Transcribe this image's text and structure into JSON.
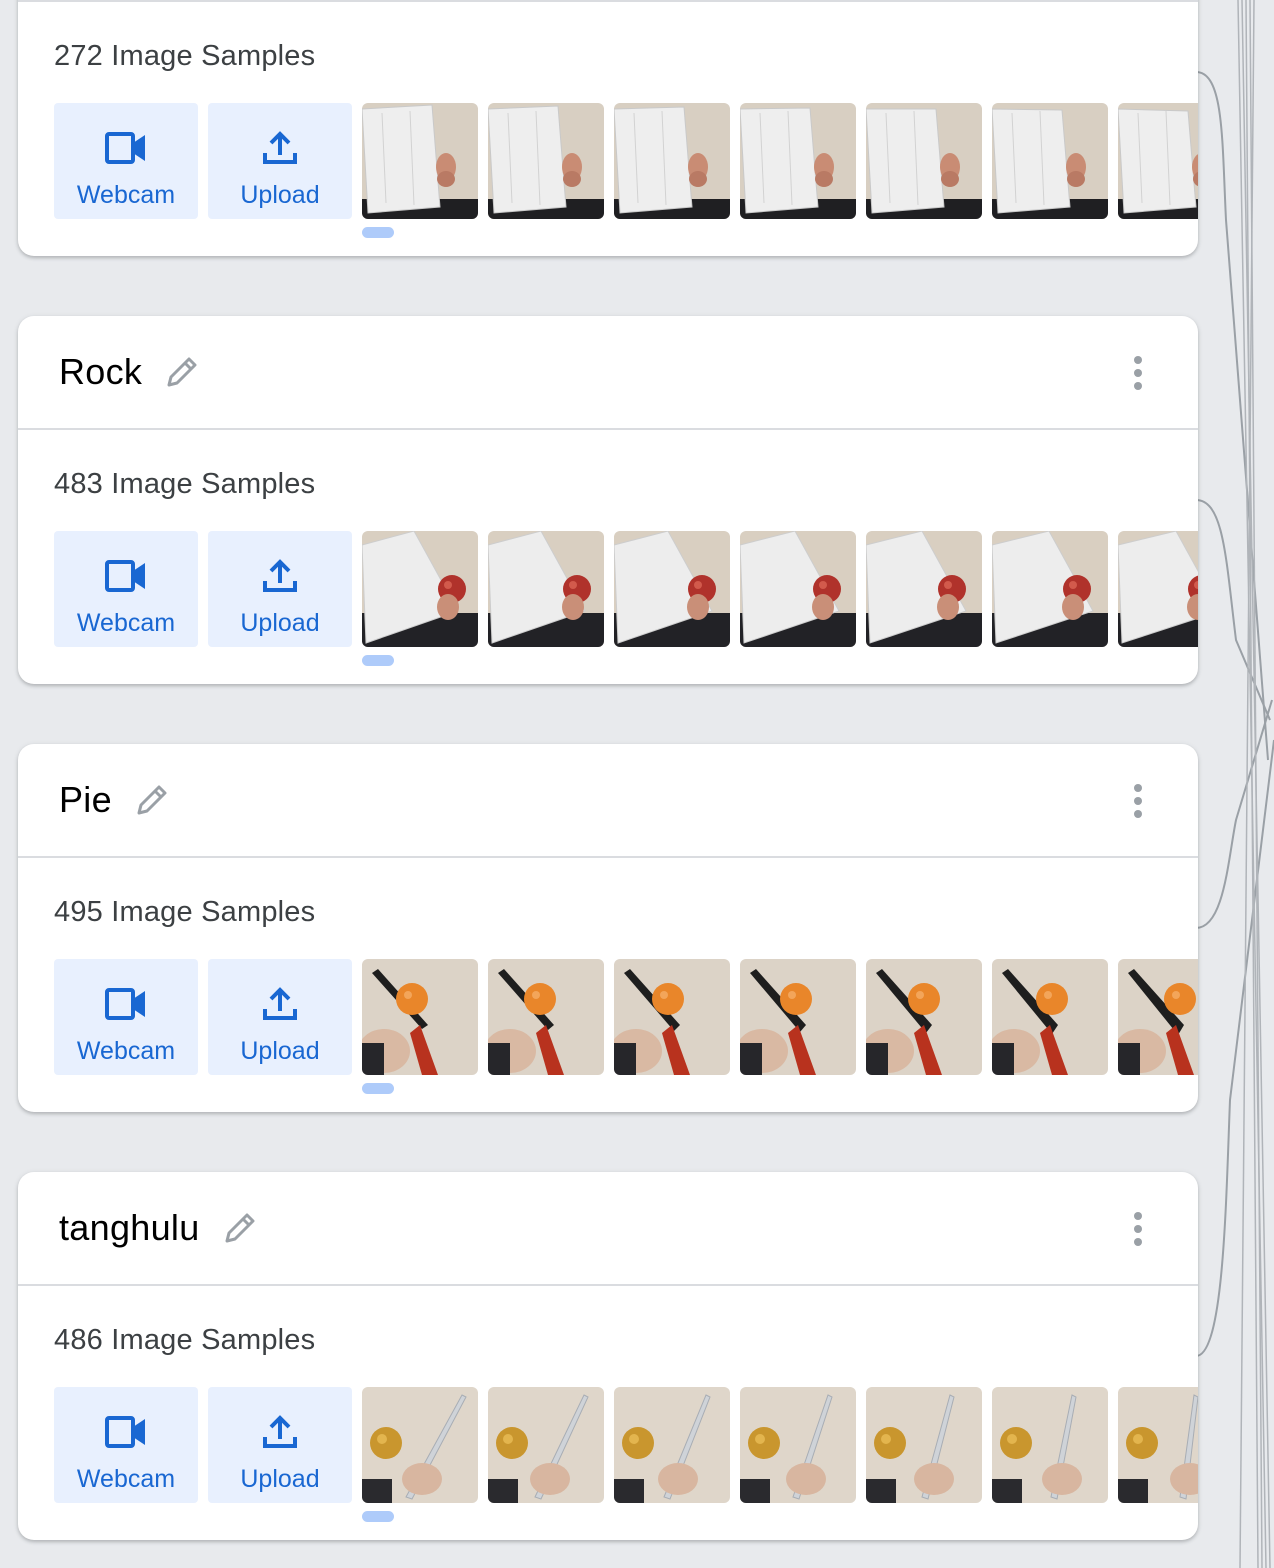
{
  "colors": {
    "page_bg": "#e8eaed",
    "accent": "#1967d2",
    "button_bg": "#e8f0fe",
    "scroll_indicator": "#aecbfa"
  },
  "buttons": {
    "webcam_label": "Webcam",
    "upload_label": "Upload",
    "webcam_icon": "videocam-icon",
    "upload_icon": "upload-icon"
  },
  "classes": [
    {
      "name": "",
      "samples_text": "272 Image Samples",
      "thumbnail_subject": "paper"
    },
    {
      "name": "Rock",
      "samples_text": "483 Image Samples",
      "thumbnail_subject": "paper-and-apple"
    },
    {
      "name": "Pie",
      "samples_text": "495 Image Samples",
      "thumbnail_subject": "knife-and-orange"
    },
    {
      "name": "tanghulu",
      "samples_text": "486 Image Samples",
      "thumbnail_subject": "apple-and-stick"
    }
  ]
}
